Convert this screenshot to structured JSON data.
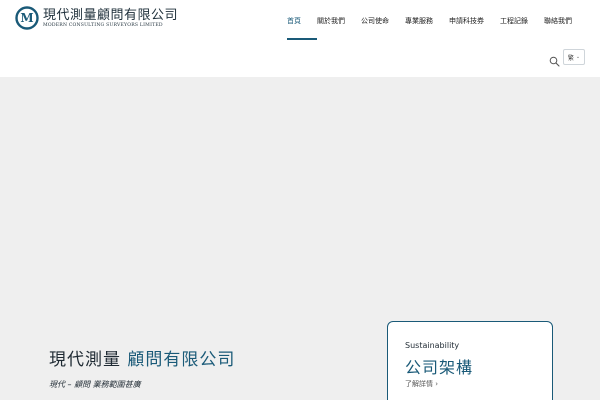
{
  "brand": {
    "logo_letter": "M",
    "name_cn": "現代測量顧問有限公司",
    "name_en": "MODERN CONSULTING SURVEYORS LIMITED",
    "color": "#1a5a78"
  },
  "nav": {
    "items": [
      {
        "label": "首頁",
        "active": true
      },
      {
        "label": "關於我們",
        "active": false
      },
      {
        "label": "公司使命",
        "active": false
      },
      {
        "label": "專業服務",
        "active": false
      },
      {
        "label": "申請科技券",
        "active": false
      },
      {
        "label": "工程記錄",
        "active": false
      },
      {
        "label": "聯絡我們",
        "active": false
      }
    ]
  },
  "toolbar": {
    "search_icon": "search-icon",
    "language_label": "繁",
    "language_chevron": "⌄"
  },
  "hero": {
    "title_main": "現代測量",
    "title_accent": "顧問有限公司",
    "subtitle": "現代 – 顧問 業務範圍甚廣"
  },
  "card": {
    "small_label": "Sustainability",
    "title": "公司架構",
    "link_label": "了解詳情",
    "link_arrow": "›"
  }
}
